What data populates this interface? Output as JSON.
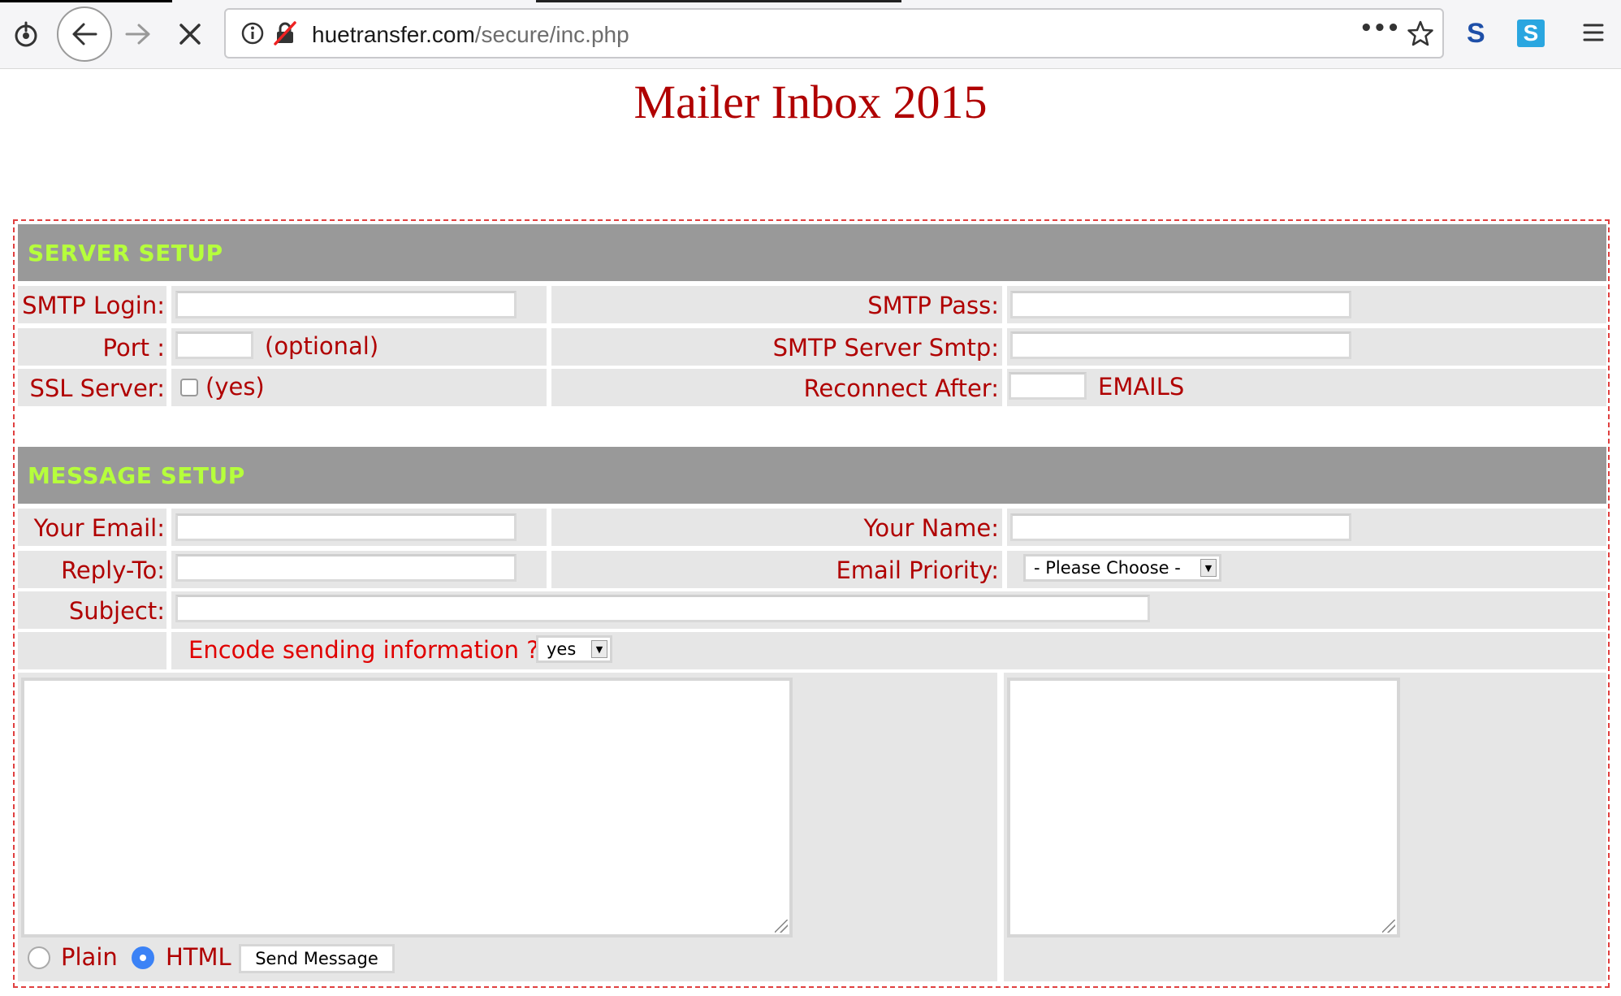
{
  "browser": {
    "url_domain": "huetransfer.com",
    "url_path": "/secure/inc.php",
    "more_glyph": "•••",
    "ext1_letter": "S",
    "ext2_letter": "S"
  },
  "page": {
    "title": "Mailer Inbox 2015"
  },
  "server_setup": {
    "header": "SERVER SETUP",
    "smtp_login_label": "SMTP Login:",
    "smtp_pass_label": "SMTP Pass:",
    "port_label": "Port :",
    "port_hint": "(optional)",
    "smtp_server_label": "SMTP Server Smtp:",
    "ssl_label": "SSL Server:",
    "ssl_option": "(yes)",
    "reconnect_label": "Reconnect After:",
    "reconnect_unit": "EMAILS"
  },
  "message_setup": {
    "header": "MESSAGE SETUP",
    "your_email_label": "Your Email:",
    "your_name_label": "Your Name:",
    "reply_to_label": "Reply-To:",
    "priority_label": "Email Priority:",
    "priority_value": "- Please Choose -",
    "subject_label": "Subject:",
    "encode_label": "Encode sending information ?",
    "encode_value": "yes",
    "format_plain": "Plain",
    "format_html": "HTML",
    "send_button": "Send Message"
  },
  "colors": {
    "label": "#b00000",
    "header_bg": "#999999",
    "header_text": "#b6ff3c",
    "row_bg": "#e6e6e6",
    "title": "#b00000"
  }
}
